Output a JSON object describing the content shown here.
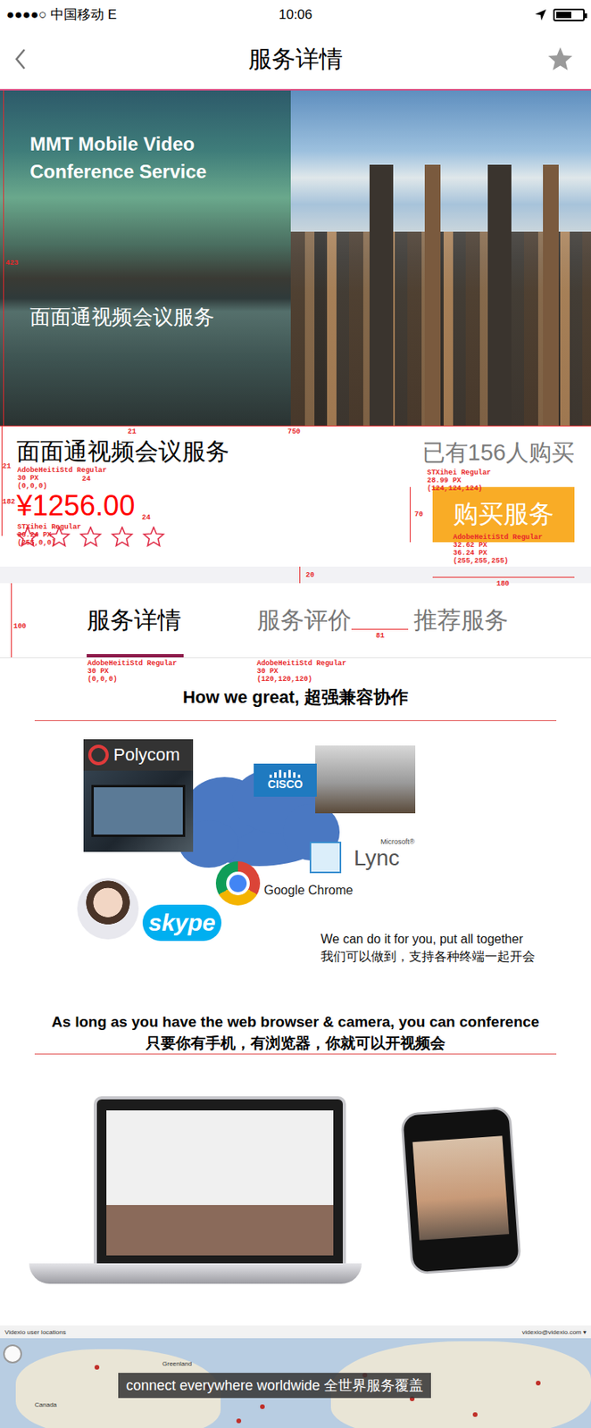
{
  "status_bar": {
    "carrier": "●●●●○ 中国移动  E",
    "time": "10:06",
    "battery": 0.6
  },
  "nav": {
    "title": "服务详情",
    "favorited": false
  },
  "hero": {
    "title": "MMT Mobile Video Conference Service",
    "subtitle": "面面通视频会议服务"
  },
  "product": {
    "name": "面面通视频会议服务",
    "price": "¥1256.00",
    "stars": 0,
    "sold": "已有156人购买",
    "buy_button": "购买服务"
  },
  "tabs": [
    {
      "label": "服务详情",
      "selected": true
    },
    {
      "label": "服务评价",
      "selected": false
    },
    {
      "label": "推荐服务",
      "selected": false
    }
  ],
  "compat": {
    "heading": "How we great, 超强兼容协作",
    "polycom": "Polycom",
    "cisco": "CISCO",
    "lync_vendor": "Microsoft®",
    "lync": "Lync",
    "chrome": "Google Chrome",
    "skype": "skype",
    "caption": [
      "We can do it for you, put all together",
      "我们可以做到，支持各种终端一起开会"
    ]
  },
  "browser": {
    "heading": [
      "As long as you have the web browser & camera, you can conference",
      "只要你有手机，有浏览器，你就可以开视频会"
    ]
  },
  "map": {
    "title": "Videxio user locations",
    "account": "videxio@videxio.com ▾",
    "labels": [
      "Greenland",
      "Canada"
    ],
    "caption": "connect everywhere worldwide 全世界服务覆盖"
  },
  "annotations": [
    {
      "text": "423"
    },
    {
      "text": "21"
    },
    {
      "text": "750"
    },
    {
      "text": "21"
    },
    {
      "text": "AdobeHeitiStd Regular\n30 PX\n(0,0,0)"
    },
    {
      "text": "24"
    },
    {
      "text": "182"
    },
    {
      "text": "STXihei Regular\n36.24 PX\n(255,0,0)"
    },
    {
      "text": "24"
    },
    {
      "text": "STXihei Regular\n28.99 PX\n(124,124,124)"
    },
    {
      "text": "70"
    },
    {
      "text": "AdobeHeitiStd Regular\n32.62 PX\n36.24 PX\n(255,255,255)"
    },
    {
      "text": "20"
    },
    {
      "text": "180"
    },
    {
      "text": "100"
    },
    {
      "text": "AdobeHeitiStd Regular\n30 PX\n(0,0,0)"
    },
    {
      "text": "AdobeHeitiStd Regular\n30 PX\n(120,120,120)"
    },
    {
      "text": "81"
    }
  ]
}
